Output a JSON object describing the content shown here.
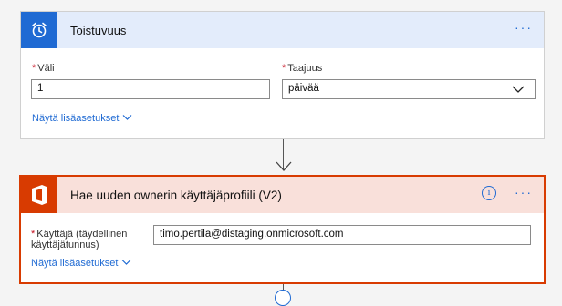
{
  "trigger": {
    "title": "Toistuvuus",
    "icon": "alarm-clock-icon",
    "more_label": "···",
    "interval_label": "Väli",
    "interval_value": "1",
    "frequency_label": "Taajuus",
    "frequency_value": "päivää",
    "advanced_link": "Näytä lisäasetukset"
  },
  "action": {
    "title": "Hae uuden ownerin käyttäjäprofiili (V2)",
    "icon": "office-logo-icon",
    "info_label": "i",
    "more_label": "···",
    "user_label_line1": "Käyttäjä (täydellinen",
    "user_label_line2": "käyttäjätunnus)",
    "user_value": "timo.pertila@distaging.onmicrosoft.com",
    "advanced_link": "Näytä lisäasetukset"
  },
  "required_marker": "*",
  "colors": {
    "accent_blue": "#1f6ad3",
    "office_orange": "#d83b01",
    "trigger_header_bg": "#e3ecfb",
    "action_header_bg": "#f9e0da",
    "required_red": "#c50f1f"
  }
}
